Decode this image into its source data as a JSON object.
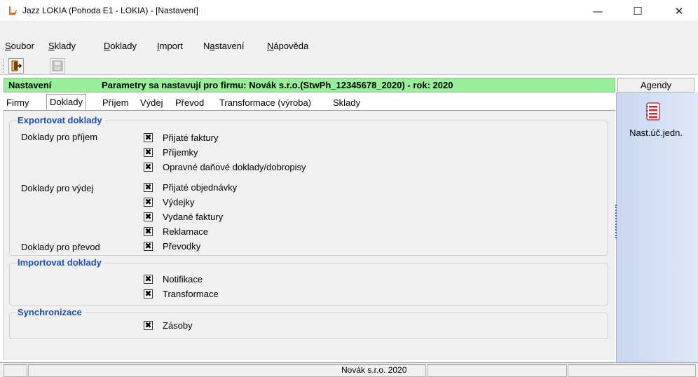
{
  "window": {
    "title": "Jazz LOKIA (Pohoda E1 - LOKIA) - [Nastavení]",
    "minimize_glyph": "—",
    "maximize_glyph": "☐",
    "close_glyph": "✕"
  },
  "menu": [
    {
      "accel": "S",
      "rest": "oubor"
    },
    {
      "accel": "S",
      "rest": "klady"
    },
    {
      "accel": "D",
      "rest": "oklady"
    },
    {
      "accel": "I",
      "rest": "mport"
    },
    {
      "pre": "N",
      "accel": "a",
      "rest": "stavení"
    },
    {
      "accel": "N",
      "rest": "ápověda"
    }
  ],
  "header": {
    "label": "Nastavení",
    "message": "Parametry sa nastavují pro firmu: Novák s.r.o.(StwPh_12345678_2020) - rok: 2020"
  },
  "tabs": [
    "Firmy",
    "Doklady",
    "Příjem",
    "Výdej",
    "Převod",
    "Transformace (výroba)",
    "Sklady"
  ],
  "active_tab": "Doklady",
  "export_group": {
    "title": "Exportovat doklady",
    "prijem_label": "Doklady pro příjem",
    "vydej_label": "Doklady pro výdej",
    "prevod_label": "Doklady pro převod",
    "items": [
      {
        "label": "Přijaté faktury",
        "checked": true
      },
      {
        "label": "Příjemky",
        "checked": true
      },
      {
        "label": "Opravné daňové doklady/dobropisy",
        "checked": true
      },
      {
        "label": "Přijaté objednávky",
        "checked": true
      },
      {
        "label": "Výdejky",
        "checked": true
      },
      {
        "label": "Vydané faktury",
        "checked": true
      },
      {
        "label": "Reklamace",
        "checked": true
      },
      {
        "label": "Převodky",
        "checked": true
      }
    ]
  },
  "import_group": {
    "title": "Importovat doklady",
    "items": [
      {
        "label": "Notifikace",
        "checked": true
      },
      {
        "label": "Transformace",
        "checked": true
      }
    ]
  },
  "sync_group": {
    "title": "Synchronizace",
    "items": [
      {
        "label": "Zásoby",
        "checked": true
      }
    ]
  },
  "checkbox_mark": "✖",
  "agendy": {
    "title": "Agendy",
    "item_label": "Nast.úč.jedn.",
    "icon": "settings-list-icon"
  },
  "statusbar": {
    "company": "Novák s.r.o. 2020"
  },
  "colors": {
    "header_green": "#99ee99",
    "group_title_blue": "#1a4fb8",
    "agendy_blue": "#c9d7ef"
  }
}
